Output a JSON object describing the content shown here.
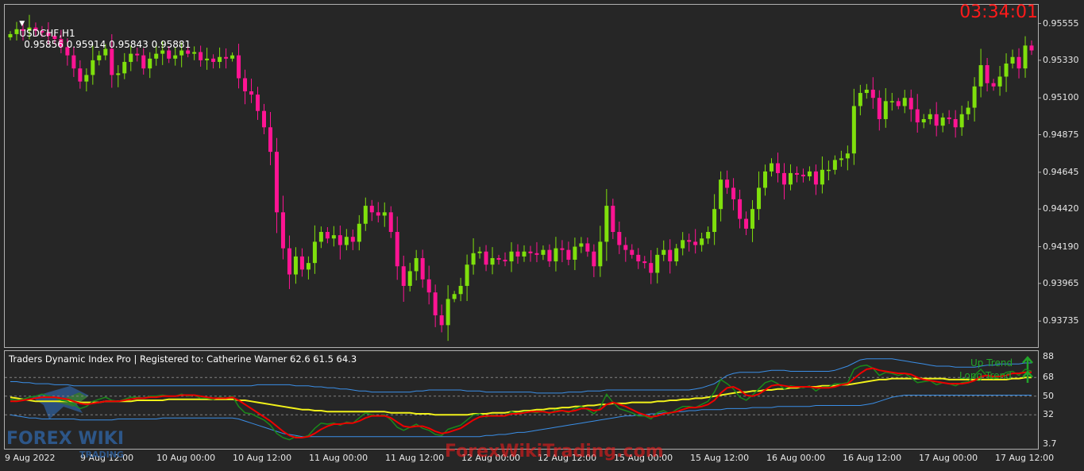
{
  "header": {
    "symbol": "USDCHF,H1",
    "ohlc": "0.95856 0.95914 0.95843 0.95881",
    "clock": "03:34:01"
  },
  "indicator": {
    "title": "Traders Dynamic Index Pro | Registered to: Catherine Warner 62.6 61.5 64.3",
    "up_trend_label": "Up Trend",
    "long_trend_label": "Long Trend"
  },
  "watermark": {
    "site": "ForexWikiTrading.com",
    "logo_text": "FOREX WIKI",
    "logo_sub": "TRADING"
  },
  "colors": {
    "background": "#262626",
    "bull": "#7fe00c",
    "bear": "#ff1493",
    "price_line": "#aaaaaa",
    "band": "#3a8ee6",
    "rsi": "#1a8a1a",
    "signal": "#ee0000",
    "base": "#f2f21a",
    "grid": "#808080"
  },
  "chart_data": [
    {
      "type": "candlestick",
      "title": "USDCHF,H1",
      "ylim": [
        0.936,
        0.9565
      ],
      "y_ticks": [
        "0.95555",
        "0.95330",
        "0.95100",
        "0.94875",
        "0.94645",
        "0.94420",
        "0.94190",
        "0.93965",
        "0.93735"
      ],
      "x_ticks": [
        "9 Aug 2022",
        "9 Aug 12:00",
        "10 Aug 00:00",
        "10 Aug 12:00",
        "11 Aug 00:00",
        "11 Aug 12:00",
        "12 Aug 00:00",
        "12 Aug 12:00",
        "15 Aug 00:00",
        "15 Aug 12:00",
        "16 Aug 00:00",
        "16 Aug 12:00",
        "17 Aug 00:00",
        "17 Aug 12:00"
      ],
      "candles_close": [
        0.9549,
        0.9552,
        0.9551,
        0.9553,
        0.9551,
        0.955,
        0.9548,
        0.9546,
        0.9541,
        0.9536,
        0.9528,
        0.952,
        0.9524,
        0.9533,
        0.9536,
        0.954,
        0.9524,
        0.9525,
        0.9532,
        0.9537,
        0.9536,
        0.9528,
        0.9534,
        0.9537,
        0.9539,
        0.9534,
        0.9536,
        0.9539,
        0.9537,
        0.9538,
        0.9533,
        0.9534,
        0.9532,
        0.9535,
        0.9534,
        0.9536,
        0.9522,
        0.9514,
        0.9512,
        0.9502,
        0.9492,
        0.9477,
        0.944,
        0.9418,
        0.9402,
        0.9413,
        0.9405,
        0.9409,
        0.9422,
        0.9428,
        0.9424,
        0.9426,
        0.942,
        0.9425,
        0.9422,
        0.9433,
        0.9444,
        0.944,
        0.9438,
        0.944,
        0.9428,
        0.9407,
        0.9395,
        0.9404,
        0.9412,
        0.9399,
        0.9391,
        0.9377,
        0.9371,
        0.9387,
        0.939,
        0.9395,
        0.9408,
        0.9415,
        0.9416,
        0.9408,
        0.9412,
        0.9411,
        0.941,
        0.9416,
        0.9413,
        0.9416,
        0.9415,
        0.9414,
        0.9417,
        0.941,
        0.9418,
        0.9417,
        0.9411,
        0.9419,
        0.9421,
        0.9416,
        0.9407,
        0.9422,
        0.9444,
        0.9428,
        0.942,
        0.9417,
        0.9414,
        0.941,
        0.9409,
        0.9403,
        0.9414,
        0.9417,
        0.941,
        0.9418,
        0.9423,
        0.9422,
        0.942,
        0.9424,
        0.9428,
        0.9442,
        0.946,
        0.9455,
        0.9448,
        0.9436,
        0.943,
        0.9442,
        0.9455,
        0.9465,
        0.947,
        0.9464,
        0.9457,
        0.9464,
        0.9463,
        0.9462,
        0.9465,
        0.9457,
        0.9466,
        0.9466,
        0.9472,
        0.9473,
        0.9476,
        0.9505,
        0.9513,
        0.9515,
        0.951,
        0.9497,
        0.9508,
        0.9508,
        0.9505,
        0.951,
        0.9503,
        0.9495,
        0.9497,
        0.95,
        0.9493,
        0.9498,
        0.9497,
        0.9492,
        0.95,
        0.9504,
        0.9517,
        0.953,
        0.9519,
        0.9517,
        0.9523,
        0.9531,
        0.9535,
        0.9528,
        0.9542,
        0.9539
      ]
    },
    {
      "type": "line",
      "title": "Traders Dynamic Index Pro",
      "ylim": [
        0,
        92
      ],
      "y_ticks": [
        "88",
        "68",
        "50",
        "32",
        "3.7"
      ],
      "levels": [
        68,
        50,
        32
      ],
      "series": [
        {
          "name": "RSI",
          "values": [
            47,
            46,
            47,
            49,
            50,
            52,
            50,
            49,
            46,
            45,
            42,
            38,
            40,
            45,
            47,
            49,
            46,
            45,
            47,
            49,
            49,
            48,
            50,
            50,
            51,
            50,
            50,
            52,
            50,
            51,
            48,
            48,
            47,
            49,
            48,
            50,
            40,
            34,
            33,
            30,
            27,
            22,
            14,
            10,
            8,
            11,
            10,
            12,
            19,
            24,
            23,
            24,
            22,
            25,
            24,
            29,
            34,
            32,
            31,
            32,
            27,
            20,
            17,
            20,
            23,
            19,
            17,
            13,
            12,
            18,
            20,
            22,
            27,
            32,
            33,
            30,
            32,
            31,
            31,
            35,
            33,
            35,
            35,
            34,
            36,
            33,
            37,
            36,
            34,
            38,
            40,
            37,
            33,
            39,
            52,
            44,
            38,
            36,
            34,
            31,
            31,
            28,
            34,
            36,
            33,
            37,
            40,
            40,
            39,
            42,
            45,
            54,
            66,
            62,
            57,
            49,
            46,
            51,
            57,
            63,
            65,
            62,
            57,
            60,
            59,
            58,
            60,
            55,
            59,
            59,
            62,
            62,
            63,
            76,
            79,
            80,
            77,
            70,
            73,
            72,
            70,
            72,
            68,
            63,
            64,
            65,
            61,
            63,
            62,
            60,
            63,
            64,
            70,
            76,
            69,
            67,
            69,
            73,
            74,
            70,
            76,
            74
          ]
        },
        {
          "name": "Signal",
          "values": [
            45,
            45,
            46,
            47,
            48,
            49,
            49,
            49,
            48,
            47,
            45,
            43,
            42,
            43,
            44,
            45,
            45,
            45,
            46,
            47,
            48,
            48,
            49,
            49,
            50,
            50,
            50,
            51,
            51,
            51,
            50,
            49,
            48,
            48,
            48,
            49,
            46,
            42,
            38,
            34,
            30,
            26,
            21,
            16,
            12,
            10,
            10,
            11,
            14,
            18,
            21,
            23,
            23,
            24,
            24,
            26,
            29,
            31,
            31,
            31,
            29,
            25,
            21,
            20,
            21,
            21,
            19,
            16,
            14,
            15,
            17,
            19,
            23,
            27,
            30,
            31,
            31,
            31,
            31,
            33,
            33,
            34,
            35,
            35,
            35,
            34,
            35,
            36,
            35,
            36,
            38,
            38,
            36,
            37,
            42,
            44,
            42,
            40,
            37,
            34,
            32,
            30,
            31,
            33,
            34,
            35,
            37,
            39,
            39,
            40,
            42,
            46,
            53,
            58,
            59,
            56,
            51,
            50,
            52,
            56,
            60,
            61,
            60,
            59,
            59,
            59,
            59,
            58,
            58,
            58,
            59,
            61,
            62,
            67,
            72,
            76,
            77,
            75,
            74,
            73,
            72,
            72,
            71,
            68,
            66,
            65,
            64,
            63,
            62,
            62,
            62,
            63,
            65,
            69,
            70,
            69,
            69,
            70,
            72,
            72,
            73,
            73
          ]
        },
        {
          "name": "Base",
          "values": [
            49,
            48,
            47,
            46,
            45,
            45,
            45,
            45,
            45,
            45,
            45,
            44,
            44,
            44,
            44,
            45,
            45,
            45,
            45,
            45,
            46,
            46,
            46,
            46,
            46,
            47,
            47,
            47,
            47,
            47,
            47,
            47,
            47,
            47,
            47,
            47,
            46,
            46,
            45,
            44,
            43,
            42,
            41,
            40,
            39,
            38,
            37,
            37,
            36,
            36,
            35,
            35,
            35,
            35,
            35,
            35,
            35,
            35,
            35,
            35,
            34,
            34,
            34,
            34,
            33,
            33,
            33,
            32,
            32,
            32,
            32,
            32,
            32,
            33,
            33,
            33,
            34,
            34,
            34,
            35,
            35,
            36,
            36,
            37,
            37,
            38,
            38,
            39,
            39,
            40,
            40,
            41,
            41,
            42,
            42,
            43,
            43,
            43,
            44,
            44,
            44,
            44,
            45,
            45,
            46,
            46,
            47,
            47,
            48,
            48,
            49,
            50,
            51,
            52,
            53,
            54,
            54,
            55,
            55,
            56,
            56,
            57,
            57,
            58,
            58,
            59,
            59,
            59,
            60,
            60,
            60,
            61,
            61,
            62,
            63,
            64,
            65,
            66,
            66,
            67,
            67,
            67,
            67,
            67,
            67,
            67,
            67,
            67,
            66,
            66,
            66,
            66,
            66,
            66,
            66,
            66,
            66,
            66,
            67,
            67,
            68,
            68
          ]
        },
        {
          "name": "Upper Band",
          "values": [
            64,
            64,
            63,
            63,
            62,
            62,
            62,
            61,
            61,
            61,
            60,
            60,
            60,
            60,
            60,
            60,
            60,
            60,
            60,
            60,
            60,
            60,
            60,
            60,
            60,
            60,
            60,
            60,
            60,
            60,
            60,
            60,
            60,
            60,
            60,
            60,
            60,
            60,
            60,
            61,
            61,
            61,
            61,
            61,
            61,
            60,
            60,
            60,
            59,
            59,
            58,
            58,
            57,
            57,
            56,
            55,
            55,
            54,
            54,
            54,
            54,
            54,
            54,
            54,
            55,
            55,
            56,
            56,
            56,
            56,
            56,
            56,
            55,
            55,
            55,
            54,
            54,
            54,
            54,
            54,
            54,
            54,
            54,
            53,
            53,
            53,
            53,
            53,
            54,
            54,
            54,
            55,
            55,
            55,
            56,
            56,
            56,
            56,
            56,
            56,
            56,
            56,
            56,
            56,
            56,
            56,
            56,
            56,
            57,
            58,
            60,
            62,
            66,
            70,
            72,
            73,
            73,
            73,
            73,
            74,
            75,
            75,
            75,
            74,
            74,
            74,
            74,
            74,
            74,
            74,
            75,
            77,
            79,
            82,
            85,
            86,
            86,
            86,
            86,
            86,
            85,
            84,
            83,
            82,
            81,
            80,
            79,
            79,
            79,
            78,
            78,
            78,
            78,
            79,
            80,
            80,
            81,
            81,
            81,
            81,
            82,
            82
          ]
        },
        {
          "name": "Lower Band",
          "values": [
            32,
            31,
            30,
            29,
            29,
            28,
            28,
            28,
            28,
            28,
            28,
            27,
            27,
            27,
            27,
            27,
            27,
            28,
            28,
            28,
            28,
            28,
            28,
            28,
            29,
            29,
            29,
            29,
            29,
            29,
            29,
            29,
            29,
            29,
            29,
            29,
            28,
            26,
            24,
            22,
            20,
            18,
            16,
            14,
            13,
            12,
            11,
            11,
            11,
            11,
            11,
            11,
            11,
            11,
            11,
            11,
            11,
            11,
            11,
            11,
            11,
            11,
            11,
            11,
            11,
            11,
            11,
            11,
            11,
            11,
            11,
            11,
            11,
            11,
            11,
            12,
            12,
            13,
            13,
            14,
            15,
            15,
            16,
            17,
            18,
            19,
            20,
            21,
            22,
            23,
            24,
            25,
            26,
            27,
            28,
            29,
            30,
            31,
            31,
            32,
            32,
            33,
            33,
            34,
            34,
            35,
            35,
            36,
            36,
            37,
            37,
            37,
            37,
            38,
            38,
            38,
            38,
            39,
            39,
            39,
            39,
            40,
            40,
            40,
            40,
            40,
            40,
            41,
            41,
            41,
            41,
            41,
            41,
            41,
            41,
            42,
            43,
            45,
            47,
            49,
            50,
            51,
            51,
            51,
            51,
            51,
            51,
            51,
            51,
            51,
            51,
            51,
            51,
            51,
            51,
            51,
            51,
            51,
            51,
            51,
            51,
            51
          ]
        }
      ]
    }
  ]
}
